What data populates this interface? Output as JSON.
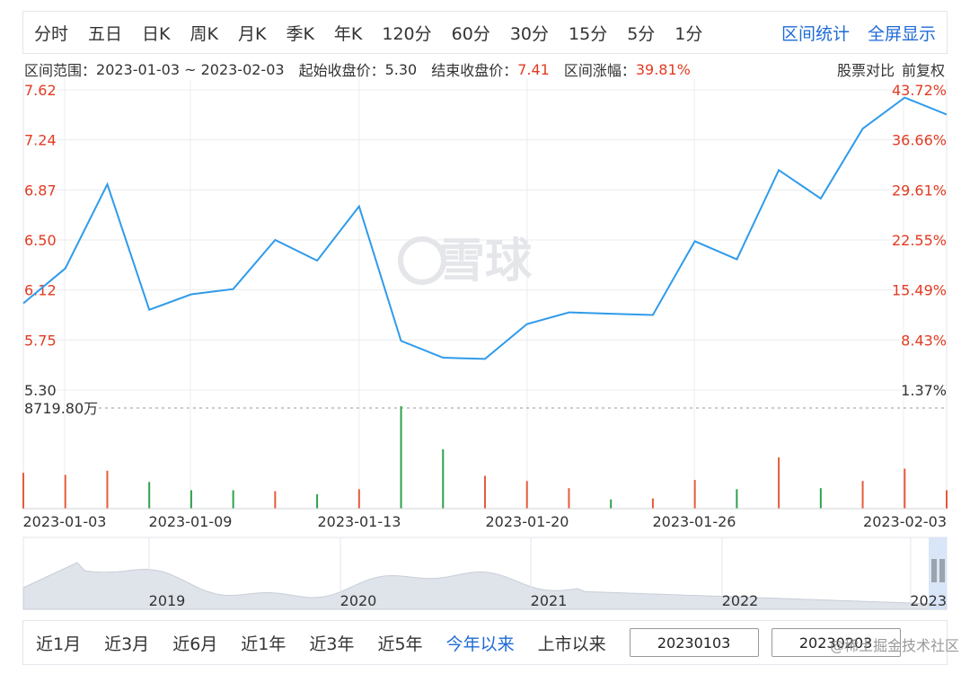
{
  "periods": [
    "分时",
    "五日",
    "日K",
    "周K",
    "月K",
    "季K",
    "年K",
    "120分",
    "60分",
    "30分",
    "15分",
    "5分",
    "1分"
  ],
  "top_links": {
    "range_stats": "区间统计",
    "fullscreen": "全屏显示"
  },
  "info": {
    "range_label": "区间范围：",
    "range_value": "2023-01-03 ~ 2023-02-03",
    "start_label": "起始收盘价：",
    "start_value": "5.30",
    "end_label": "结束收盘价：",
    "end_value": "7.41",
    "change_label": "区间涨幅：",
    "change_value": "39.81%",
    "compare": "股票对比",
    "adjust": "前复权"
  },
  "watermark": "雪球",
  "volume_label": "8719.80万",
  "chart_data": {
    "type": "line",
    "y_left_ticks": [
      "7.62",
      "7.24",
      "6.87",
      "6.50",
      "6.12",
      "5.75",
      "5.30"
    ],
    "y_right_ticks": [
      "43.72%",
      "36.66%",
      "29.61%",
      "22.55%",
      "15.49%",
      "8.43%",
      "1.37%"
    ],
    "ylim": [
      5.3,
      7.62
    ],
    "x_labels": [
      "2023-01-03",
      "2023-01-09",
      "2023-01-13",
      "2023-01-20",
      "2023-01-26",
      "2023-02-03"
    ],
    "x_label_index": [
      1,
      4,
      8,
      12,
      16,
      22
    ],
    "prices": [
      5.97,
      6.24,
      6.89,
      5.92,
      6.04,
      6.08,
      6.46,
      6.3,
      6.72,
      5.68,
      5.55,
      5.54,
      5.81,
      5.9,
      5.89,
      5.88,
      6.45,
      6.31,
      7.0,
      6.78,
      7.32,
      7.56,
      7.43
    ],
    "volume_max_label": "8719.80万",
    "volumes": [
      0.35,
      0.33,
      0.37,
      0.26,
      0.18,
      0.18,
      0.17,
      0.14,
      0.19,
      1.0,
      0.58,
      0.32,
      0.27,
      0.2,
      0.09,
      0.1,
      0.28,
      0.19,
      0.5,
      0.2,
      0.27,
      0.39,
      0.18
    ],
    "volume_colors": [
      "red",
      "red",
      "red",
      "green",
      "green",
      "green",
      "red",
      "green",
      "red",
      "green",
      "green",
      "red",
      "red",
      "red",
      "green",
      "red",
      "red",
      "green",
      "red",
      "green",
      "red",
      "red",
      "red"
    ],
    "overview_years": [
      "2019",
      "2020",
      "2021",
      "2022",
      "2023"
    ],
    "colors": {
      "line": "#2f9bea",
      "up": "#e55b3c",
      "down": "#2ea24a",
      "axis_red": "#e23b22",
      "grid": "#ececec"
    }
  },
  "bottom": {
    "ranges": [
      "近1月",
      "近3月",
      "近6月",
      "近1年",
      "近3年",
      "近5年",
      "今年以来",
      "上市以来"
    ],
    "active_range": 6,
    "start_date": "20230103",
    "end_date": "20230203"
  },
  "credit": "@稀土掘金技术社区"
}
